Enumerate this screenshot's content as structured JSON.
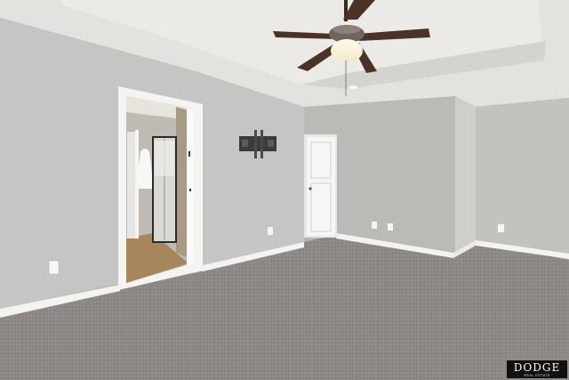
{
  "photo": {
    "subject": "empty-bedroom",
    "colors": {
      "wall_left": "#c4c4c3",
      "wall_right": "#bebdba",
      "ceiling": "#e4e3df",
      "carpet": "#8d8886",
      "trim": "#f2f2f0",
      "bath_floor": "#a8865c",
      "fan_blade": "#4a3226"
    }
  },
  "watermark": {
    "name": "DODGE",
    "tagline": "REAL ESTATE"
  }
}
